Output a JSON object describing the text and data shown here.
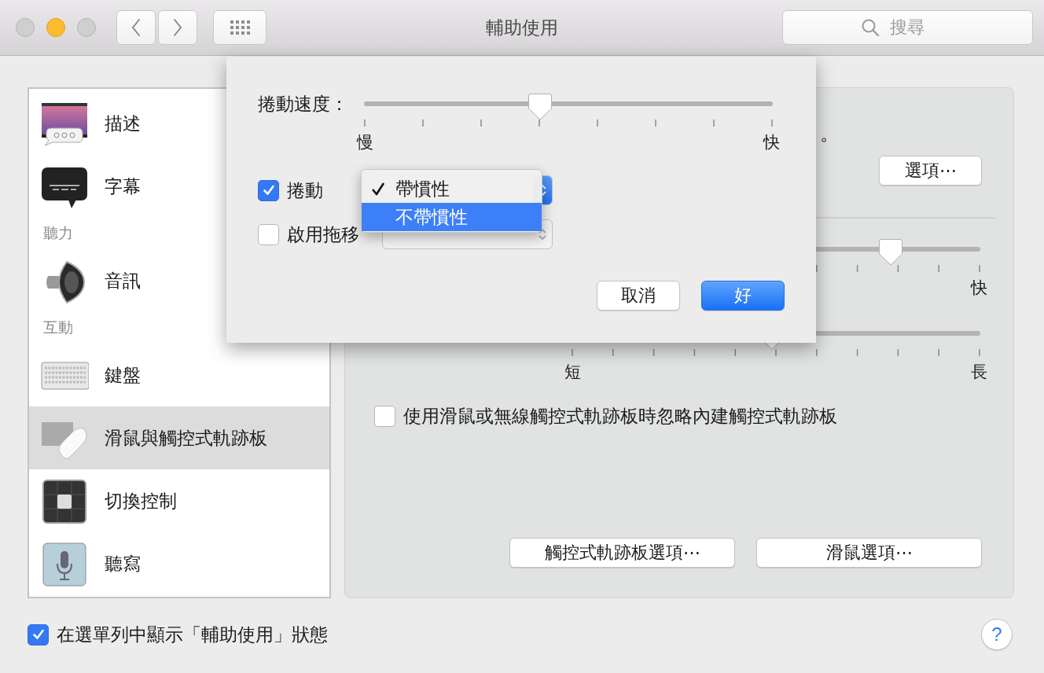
{
  "window": {
    "title": "輔助使用",
    "traffic_lights": [
      {
        "kind": "close",
        "enabled": false
      },
      {
        "kind": "minimize",
        "enabled": true
      },
      {
        "kind": "zoom",
        "enabled": false
      }
    ]
  },
  "toolbar": {
    "search": {
      "placeholder": "搜尋"
    }
  },
  "sidebar": {
    "items": [
      {
        "kind": "item",
        "label": "描述",
        "selected": false
      },
      {
        "kind": "item",
        "label": "字幕",
        "selected": false
      },
      {
        "kind": "heading",
        "label": "聽力"
      },
      {
        "kind": "item",
        "label": "音訊",
        "selected": false
      },
      {
        "kind": "heading",
        "label": "互動"
      },
      {
        "kind": "item",
        "label": "鍵盤",
        "selected": false
      },
      {
        "kind": "item",
        "label": "滑鼠與觸控式軌跡板",
        "selected": true
      },
      {
        "kind": "item",
        "label": "切換控制",
        "selected": false
      },
      {
        "kind": "item",
        "label": "聽寫",
        "selected": false
      }
    ]
  },
  "panel": {
    "description_fragment": "。",
    "options_button": "選項⋯",
    "sliders": [
      {
        "max_label": "快",
        "level": 0.78
      },
      {
        "min_label": "短",
        "max_label": "長",
        "level": 0.49
      }
    ],
    "ignore_checkbox": {
      "label": "使用滑鼠或無線觸控式軌跡板時忽略內建觸控式軌跡板",
      "checked": false
    },
    "buttons": [
      "觸控式軌跡板選項⋯",
      "滑鼠選項⋯"
    ]
  },
  "sheet": {
    "speed_slider": {
      "label": "捲動速度：",
      "min_label": "慢",
      "max_label": "快",
      "level": 0.43
    },
    "options": [
      {
        "label": "捲動",
        "checked": true,
        "popup_enabled": true
      },
      {
        "label": "啟用拖移",
        "checked": false,
        "popup_enabled": false
      }
    ],
    "menu": {
      "items": [
        {
          "label": "帶慣性",
          "checked": true,
          "selected": false
        },
        {
          "label": "不帶慣性",
          "checked": false,
          "selected": true
        }
      ]
    },
    "buttons": [
      {
        "label": "取消",
        "default": false
      },
      {
        "label": "好",
        "default": true
      }
    ]
  },
  "footer": {
    "menu_bar_checkbox": {
      "label": "在選單列中顯示「輔助使用」狀態",
      "checked": true
    },
    "help": "?"
  }
}
